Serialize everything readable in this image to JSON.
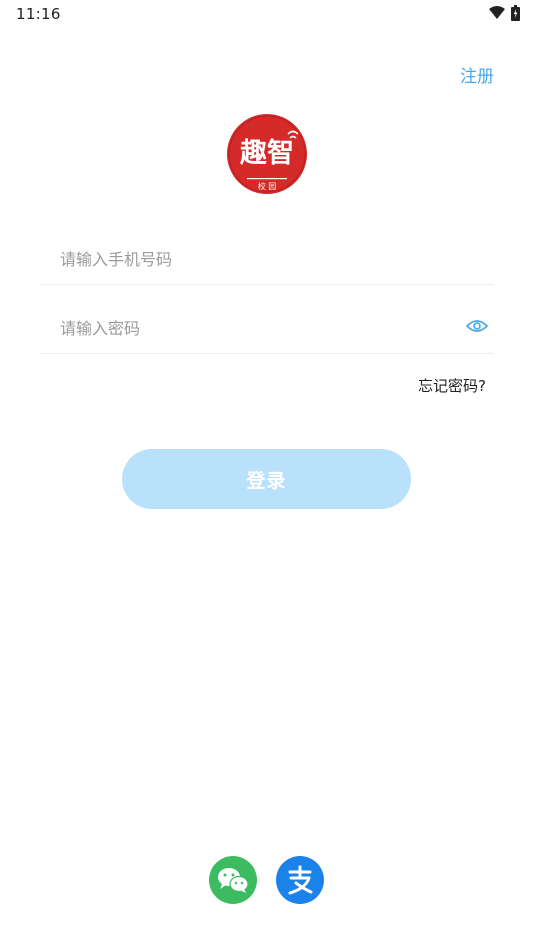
{
  "status_bar": {
    "time": "11:16",
    "icons": [
      "wifi-icon",
      "battery-icon"
    ]
  },
  "header": {
    "register_label": "注册"
  },
  "logo": {
    "text_main": "趣智",
    "text_sub": "校 园",
    "color": "#d42a2a"
  },
  "form": {
    "phone_placeholder": "请输入手机号码",
    "phone_value": "",
    "password_placeholder": "请输入密码",
    "password_value": "",
    "forgot_label": "忘记密码?",
    "login_label": "登录"
  },
  "third_party": {
    "items": [
      "wechat-icon",
      "alipay-icon"
    ]
  },
  "colors": {
    "accent": "#4aa8e8",
    "login_button": "#b9e1fb",
    "wechat": "#3dbb61",
    "alipay": "#1b82ea"
  }
}
